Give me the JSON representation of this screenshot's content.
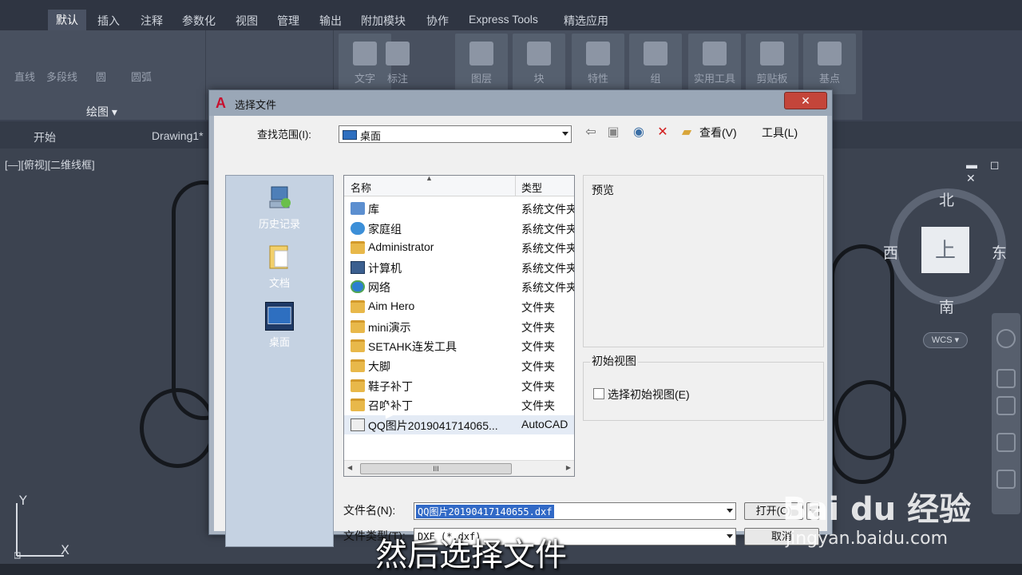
{
  "ribbon": {
    "tabs": [
      "默认",
      "插入",
      "注释",
      "参数化",
      "视图",
      "管理",
      "输出",
      "附加模块",
      "协作",
      "Express Tools",
      "精选应用"
    ],
    "draw_tools": [
      "直线",
      "多段线",
      "圆",
      "圆弧"
    ],
    "draw_panel_title": "绘图 ▾",
    "big_tools": [
      "文字",
      "标注",
      "图层",
      "块",
      "特性",
      "组",
      "实用工具",
      "剪贴板",
      "基点"
    ]
  },
  "doc_tabs": [
    "开始",
    "Drawing1*"
  ],
  "viewport_label": "[—][俯视][二维线框]",
  "viewcube": {
    "top": "上",
    "north": "北",
    "south": "南",
    "east": "东",
    "west": "西",
    "wcs": "WCS ▾"
  },
  "ucs": {
    "x": "X",
    "y": "Y"
  },
  "dialog": {
    "title": "选择文件",
    "look_in_label": "查找范围(I):",
    "look_in_value": "桌面",
    "toolbar": {
      "views": "查看(V)",
      "tools": "工具(L)"
    },
    "places": [
      {
        "label": "历史记录",
        "icon": "history-icon"
      },
      {
        "label": "文档",
        "icon": "documents-folder-icon"
      },
      {
        "label": "桌面",
        "icon": "desktop-icon",
        "selected": true
      }
    ],
    "columns": {
      "name": "名称",
      "type": "类型"
    },
    "files": [
      {
        "name": "库",
        "type": "系统文件夹",
        "icon": "library-icon"
      },
      {
        "name": "家庭组",
        "type": "系统文件夹",
        "icon": "homegroup-icon"
      },
      {
        "name": "Administrator",
        "type": "系统文件夹",
        "icon": "user-folder-icon"
      },
      {
        "name": "计算机",
        "type": "系统文件夹",
        "icon": "computer-icon"
      },
      {
        "name": "网络",
        "type": "系统文件夹",
        "icon": "network-icon"
      },
      {
        "name": "Aim Hero",
        "type": "文件夹",
        "icon": "folder-icon"
      },
      {
        "name": "mini演示",
        "type": "文件夹",
        "icon": "folder-icon"
      },
      {
        "name": "SETAHK连发工具",
        "type": "文件夹",
        "icon": "folder-icon"
      },
      {
        "name": "大脚",
        "type": "文件夹",
        "icon": "folder-icon"
      },
      {
        "name": "鞋子补丁",
        "type": "文件夹",
        "icon": "folder-icon"
      },
      {
        "name": "召唤补丁",
        "type": "文件夹",
        "icon": "folder-icon"
      },
      {
        "name": "QQ图片2019041714065...",
        "type": "AutoCAD",
        "icon": "dxf-file-icon"
      }
    ],
    "scroll_grip": "III",
    "preview_label": "预览",
    "initial_view_label": "初始视图",
    "select_initial_view": "选择初始视图(E)",
    "filename_label": "文件名(N):",
    "filename_value": "QQ图片20190417140655.dxf",
    "filetype_label": "文件类型(T):",
    "filetype_value": "DXF (*.dxf)",
    "open_button": "打开(O)",
    "cancel_button": "取消"
  },
  "caption": "然后选择文件",
  "watermark": {
    "brand": "Bai du 经验",
    "url": "jingyan.baidu.com"
  }
}
